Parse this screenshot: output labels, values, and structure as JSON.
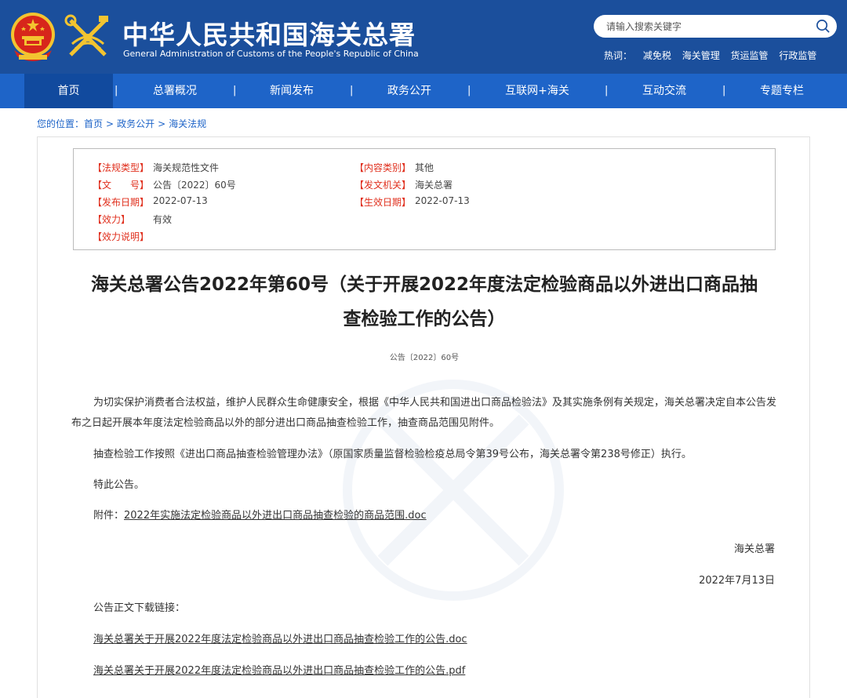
{
  "header": {
    "site_title": "中华人民共和国海关总署",
    "site_subtitle": "General Administration of Customs of the People's Republic of China",
    "search_placeholder": "请输入搜索关键字",
    "hot_label": "热词：",
    "hot_words": [
      "减免税",
      "海关管理",
      "货运监管",
      "行政监管"
    ]
  },
  "nav": {
    "items": [
      "首页",
      "总署概况",
      "新闻发布",
      "政务公开",
      "互联网+海关",
      "互动交流",
      "专题专栏"
    ],
    "separator": "|",
    "active": "首页"
  },
  "breadcrumb": {
    "prefix": "您的位置：",
    "items": [
      "首页",
      "政务公开",
      "海关法规"
    ],
    "separator": ">"
  },
  "info": {
    "law_type_label": "【法规类型】",
    "law_type": "海关规范性文件",
    "content_category_label": "【内容类别】",
    "content_category": "其他",
    "doc_no_label": "【文　　号】",
    "doc_no": "公告〔2022〕60号",
    "issuer_label": "【发文机关】",
    "issuer": "海关总署",
    "publish_date_label": "【发布日期】",
    "publish_date": "2022-07-13",
    "effective_date_label": "【生效日期】",
    "effective_date": "2022-07-13",
    "validity_label": "【效力】",
    "validity": "有效",
    "validity_note_label": "【效力说明】",
    "validity_note": ""
  },
  "document": {
    "title_line1": "海关总署公告2022年第60号（关于开展2022年度法定检验商品以外进出口商品抽",
    "title_line2": "查检验工作的公告）",
    "number": "公告〔2022〕60号",
    "para1": "为切实保护消费者合法权益，维护人民群众生命健康安全，根据《中华人民共和国进出口商品检验法》及其实施条例有关规定，海关总署决定自本公告发布之日起开展本年度法定检验商品以外的部分进出口商品抽查检验工作，抽查商品范围见附件。",
    "para2": "抽查检验工作按照《进出口商品抽查检验管理办法》（原国家质量监督检验检疫总局令第39号公布，海关总署令第238号修正）执行。",
    "para3": "特此公告。",
    "attachment_label": "附件：",
    "attachment_link": "2022年实施法定检验商品以外进出口商品抽查检验的商品范围.doc",
    "signature": "海关总署",
    "date": "2022年7月13日",
    "download_label": "公告正文下载链接：",
    "download_doc": "海关总署关于开展2022年度法定检验商品以外进出口商品抽查检验工作的公告.doc",
    "download_pdf": "海关总署关于开展2022年度法定检验商品以外进出口商品抽查检验工作的公告.pdf"
  },
  "colors": {
    "header_bg": "#1b4f9c",
    "nav_bg": "#1e64c8",
    "nav_active": "#114a9e",
    "label_red": "#e0301e",
    "emblem_red": "#d7261b",
    "emblem_gold": "#f3c430"
  }
}
